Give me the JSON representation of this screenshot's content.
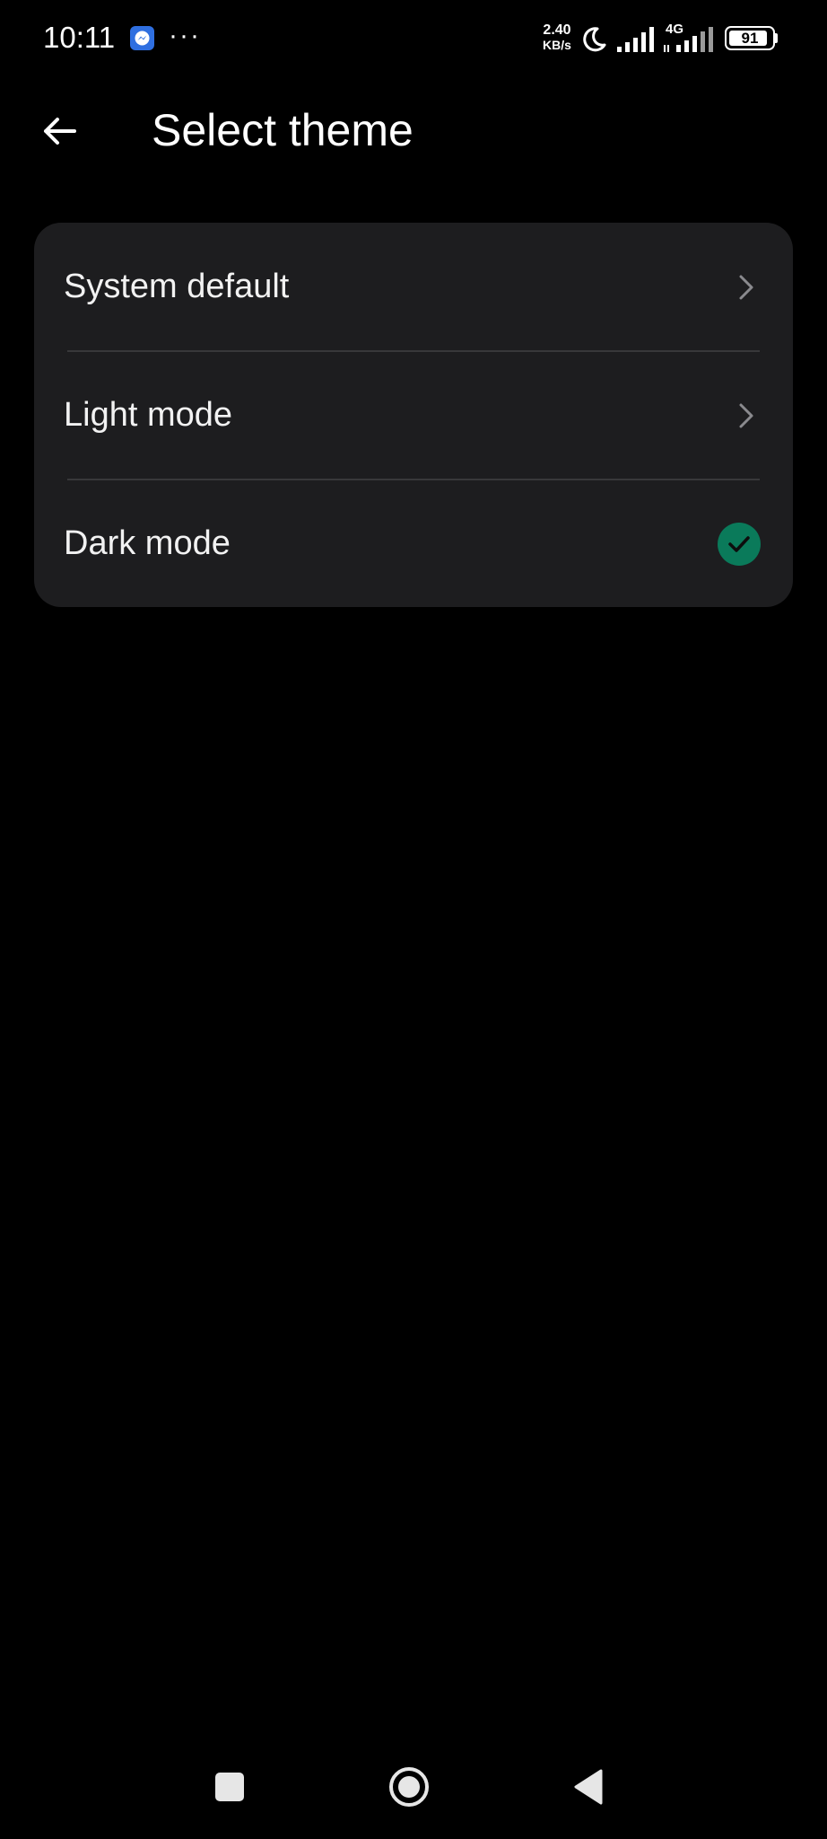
{
  "status_bar": {
    "time": "10:11",
    "overflow_indicator": "···",
    "network_speed_value": "2.40",
    "network_speed_unit": "KB/s",
    "network_type": "4G",
    "battery_level": "91",
    "battery_fraction": 0.91,
    "icons": [
      "messenger-icon",
      "moon-icon",
      "signal-icon",
      "signal-icon",
      "battery-icon"
    ]
  },
  "header": {
    "title": "Select theme",
    "back_icon": "arrow-left-icon"
  },
  "theme_options": [
    {
      "label": "System default",
      "trailing_icon": "chevron-right-icon",
      "selected": false
    },
    {
      "label": "Light mode",
      "trailing_icon": "chevron-right-icon",
      "selected": false
    },
    {
      "label": "Dark mode",
      "trailing_icon": "check-icon",
      "selected": true
    }
  ],
  "nav_bar": {
    "buttons": [
      "recents-icon",
      "home-icon",
      "back-icon"
    ]
  },
  "colors": {
    "background": "#000000",
    "card": "#1d1d1f",
    "accent_check": "#0a7a5a",
    "messenger": "#2f6fe0"
  }
}
